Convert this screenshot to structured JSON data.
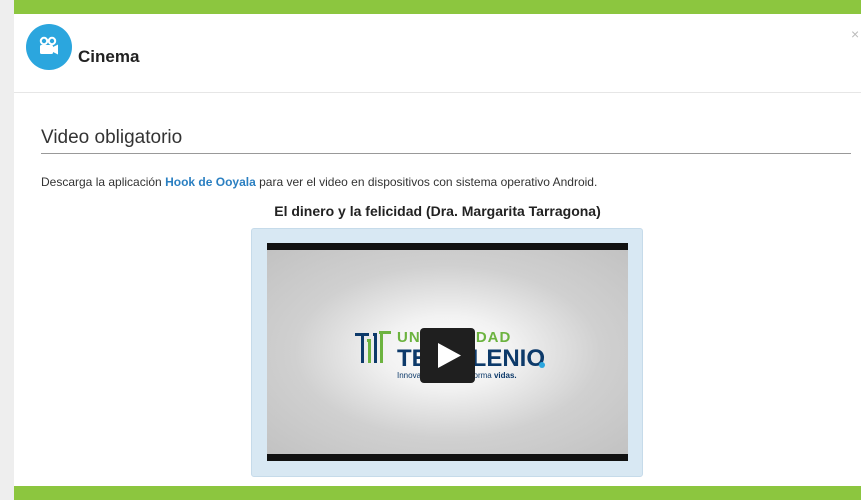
{
  "modal": {
    "title": "Cinema",
    "icon": "film-camera-icon",
    "close_label": "×"
  },
  "section": {
    "title": "Video obligatorio"
  },
  "description": {
    "prefix": "Descarga la aplicación ",
    "link_text": "Hook de Ooyala",
    "suffix": " para ver el video en dispositivos con sistema operativo Android."
  },
  "video": {
    "title": "El dinero y la felicidad (Dra. Margarita Tarragona)",
    "logo_line1": "UNIVERSIDAD",
    "logo_line2": "TECMILENIO",
    "logo_line3_prefix": "Innovación que transforma ",
    "logo_line3_bold": "vidas."
  },
  "colors": {
    "page_border": "#8cc63f",
    "icon_bg": "#2ba6de",
    "link": "#2a7fc1",
    "frame_bg": "#d8e8f3"
  }
}
